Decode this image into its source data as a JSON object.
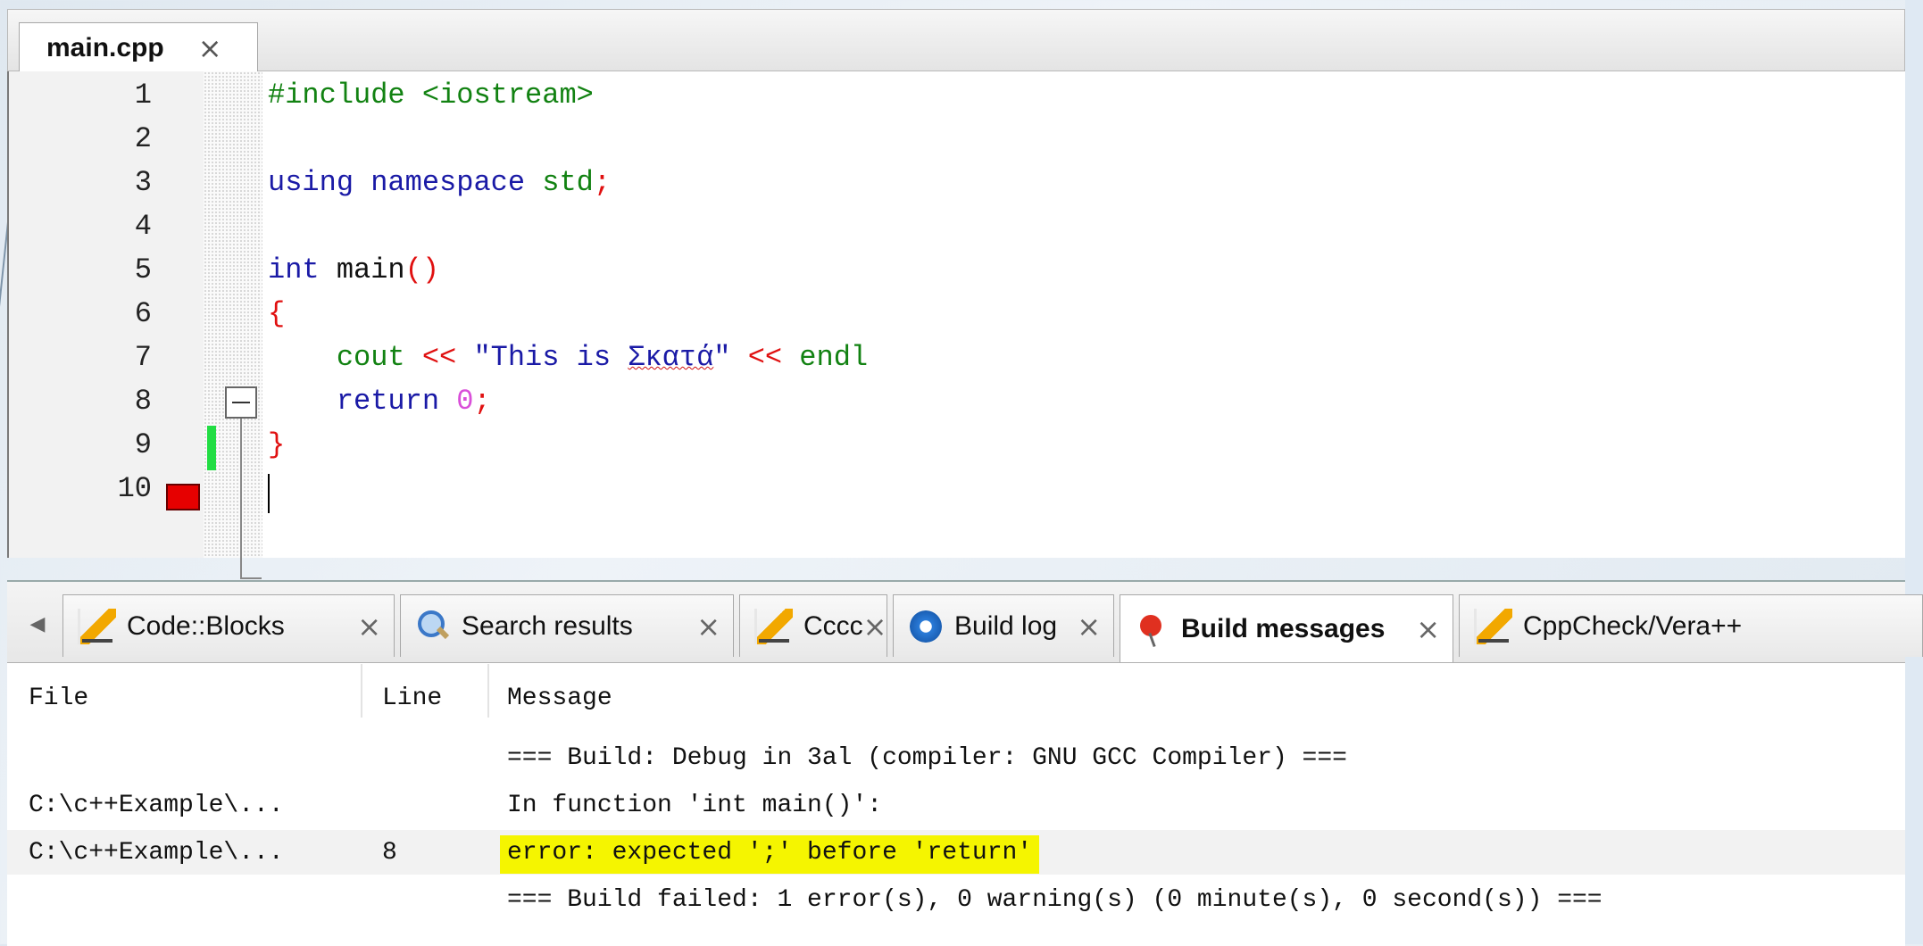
{
  "editor": {
    "tab": {
      "label": "main.cpp",
      "close": "×"
    },
    "lines": [
      {
        "n": "1",
        "tokens": [
          {
            "t": "#include <iostream>",
            "c": "pp"
          }
        ]
      },
      {
        "n": "2",
        "tokens": []
      },
      {
        "n": "3",
        "tokens": [
          {
            "t": "using namespace ",
            "c": "kw"
          },
          {
            "t": "std",
            "c": "gr"
          },
          {
            "t": ";",
            "c": "op"
          }
        ]
      },
      {
        "n": "4",
        "tokens": []
      },
      {
        "n": "5",
        "tokens": [
          {
            "t": "int ",
            "c": "kw"
          },
          {
            "t": "main",
            "c": "id"
          },
          {
            "t": "()",
            "c": "op"
          }
        ]
      },
      {
        "n": "6",
        "tokens": [
          {
            "t": "{",
            "c": "op"
          }
        ]
      },
      {
        "n": "7",
        "tokens": [
          {
            "t": "    cout ",
            "c": "gr"
          },
          {
            "t": "<<",
            "c": "op"
          },
          {
            "t": " \"This is ",
            "c": "str"
          },
          {
            "t": "Σκατά",
            "c": "str sq"
          },
          {
            "t": "\" ",
            "c": "str"
          },
          {
            "t": "<<",
            "c": "op"
          },
          {
            "t": " endl",
            "c": "gr"
          }
        ]
      },
      {
        "n": "8",
        "tokens": [
          {
            "t": "    return ",
            "c": "kw"
          },
          {
            "t": "0",
            "c": "num"
          },
          {
            "t": ";",
            "c": "op"
          }
        ]
      },
      {
        "n": "9",
        "tokens": [
          {
            "t": "}",
            "c": "op"
          }
        ]
      },
      {
        "n": "10",
        "tokens": []
      }
    ]
  },
  "panel": {
    "tabs": [
      {
        "label": "Code::Blocks",
        "icon": "pencil-icon",
        "active": false
      },
      {
        "label": "Search results",
        "icon": "magnifier-icon",
        "active": false
      },
      {
        "label": "Cccc",
        "icon": "pencil-icon",
        "active": false
      },
      {
        "label": "Build log",
        "icon": "gear-icon",
        "active": false
      },
      {
        "label": "Build messages",
        "icon": "pin-icon",
        "active": true
      },
      {
        "label": "CppCheck/Vera++",
        "icon": "pencil-icon",
        "active": false
      }
    ],
    "close": "×",
    "scroll_left": "◀",
    "columns": {
      "file": "File",
      "line": "Line",
      "message": "Message"
    },
    "rows": [
      {
        "file": "",
        "line": "",
        "message": "=== Build: Debug in 3al (compiler: GNU GCC Compiler) ===",
        "highlight": false
      },
      {
        "file": "C:\\c++Example\\...",
        "line": "",
        "message": "In function 'int main()':",
        "highlight": false
      },
      {
        "file": "C:\\c++Example\\...",
        "line": "8",
        "message": "error: expected ';' before 'return'",
        "highlight": true
      },
      {
        "file": "",
        "line": "",
        "message": "=== Build failed: 1 error(s), 0 warning(s) (0 minute(s), 0 second(s)) ===",
        "highlight": false
      }
    ]
  },
  "colors": {
    "highlight": "#f5f500",
    "breakpoint": "#e60000",
    "changed_line": "#22dd44"
  }
}
